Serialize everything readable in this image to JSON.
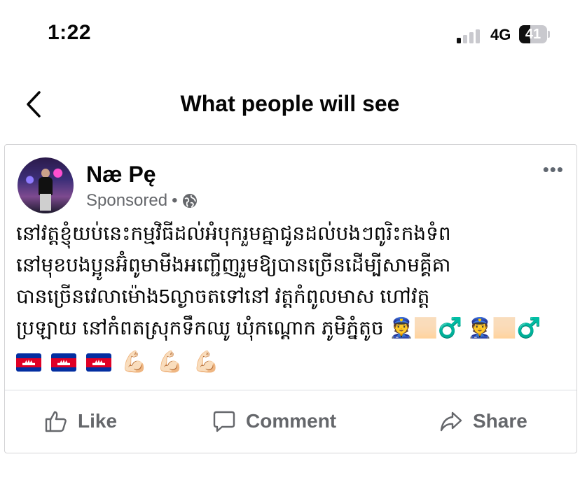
{
  "status_bar": {
    "time": "1:22",
    "network": "4G",
    "battery": "41",
    "battery_level": 0.41,
    "signal_bars_active": 1
  },
  "header": {
    "title": "What people will see",
    "back_icon": "chevron-left-icon"
  },
  "post": {
    "author": "Næ Pę",
    "sponsored_label": "Sponsored",
    "separator": "•",
    "audience_icon": "globe-icon",
    "more_icon": "•••",
    "text": "នៅវត្តខ្ញុំយប់នេះកម្មវិធីដល់អំបុករួមគ្នាជូនដល់បងៗពូរិះកងទំព\nនៅមុខបងប្អូនអ៊ំពូមាមីងអញ្ជើញរួមឱ្យបានច្រើនដើម្បីសាមគ្គីគា\nបានច្រើនវេលាម៉ោង5ល្ងាចតទៅនៅ វត្តកំពូលមាស ហៅវត្ត\nប្រឡាយ នៅកំពតស្រុកទឹកឈូ ឃុំកណ្តោក ភូមិភ្នំតូច",
    "emojis_inline": [
      "👮🏻‍♂️",
      "👮🏻‍♂️"
    ],
    "emojis_flags": [
      "cambodia-flag",
      "cambodia-flag",
      "cambodia-flag"
    ],
    "emojis_muscle": [
      "💪🏻",
      "💪🏻",
      "💪🏻"
    ]
  },
  "actions": {
    "like": "Like",
    "comment": "Comment",
    "share": "Share"
  },
  "colors": {
    "text": "#050505",
    "muted": "#65676b",
    "divider": "#dadde1",
    "flag_blue": "#032ea1",
    "flag_red": "#e00025"
  }
}
